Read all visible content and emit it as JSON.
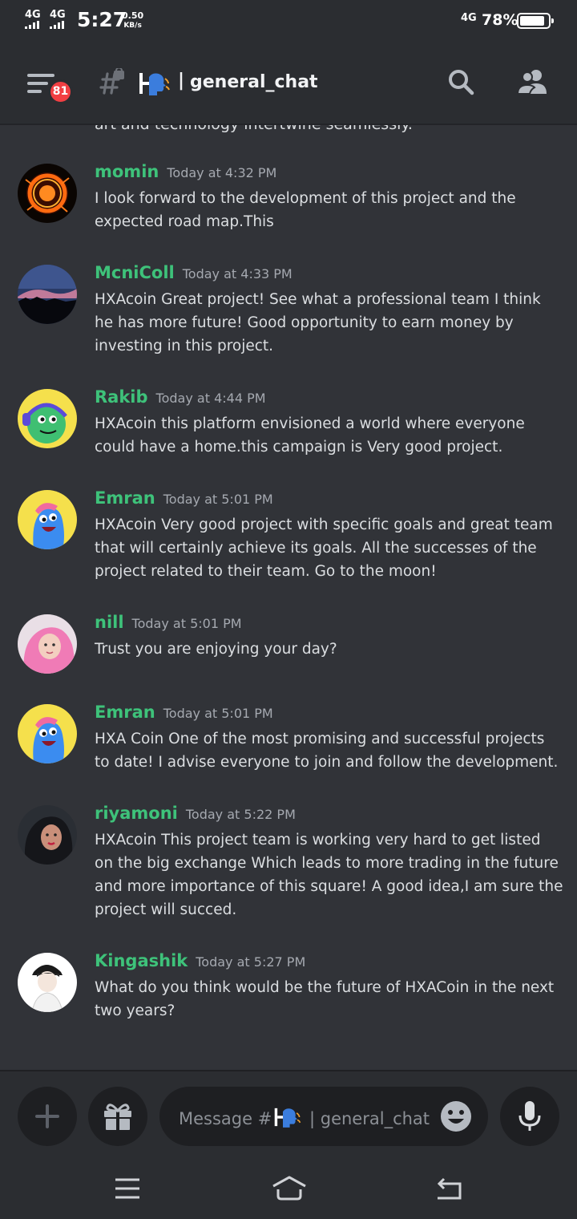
{
  "status_bar": {
    "network_1": "4G",
    "network_2": "4G",
    "time": "5:27",
    "speed_value": "0.50",
    "speed_unit": "KB/s",
    "network_3": "4G",
    "battery": "78%"
  },
  "header": {
    "notification_count": "81",
    "channel_name": "general_chat",
    "channel_emblem_icon": "speaking-head-icon"
  },
  "truncated_line": "art and technology intertwine seamlessly.",
  "messages": [
    {
      "author": "momin",
      "time": "Today at 4:32 PM",
      "text": "I look forward to the development of this project and the expected road map.This"
    },
    {
      "author": "McniColl",
      "time": "Today at 4:33 PM",
      "text": "HXAcoin Great project! See what a professional team I think he has more future! Good opportunity to earn money by investing in this project."
    },
    {
      "author": "Rakib",
      "time": "Today at 4:44 PM",
      "text": "HXAcoin this platform envisioned a world where everyone could have a home.this campaign is Very good project."
    },
    {
      "author": "Emran",
      "time": "Today at 5:01 PM",
      "text": "HXAcoin Very good project with specific goals and great team that will certainly achieve its goals. All the successes of the project related to their team. Go to the moon!"
    },
    {
      "author": "nill",
      "time": "Today at 5:01 PM",
      "text": "Trust you are enjoying your day?"
    },
    {
      "author": "Emran",
      "time": "Today at 5:01 PM",
      "text": "HXA Coin One of the most promising and successful projects to date! I advise everyone to join and follow the development."
    },
    {
      "author": "riyamoni",
      "time": "Today at 5:22 PM",
      "text": "HXAcoin This project team is working very hard to get listed on the big exchange Which leads to more trading in the future and more importance of this square! A good idea,I am sure the project will succed."
    },
    {
      "author": "Kingashik",
      "time": "Today at 5:27 PM",
      "text": "What do you think would be the future of HXACoin in the next two years?"
    }
  ],
  "composer": {
    "placeholder_prefix": "Message #",
    "placeholder_channel": "general_chat"
  },
  "colors": {
    "background": "#313338",
    "author_green": "#3ec27a",
    "badge_red": "#f23f43"
  }
}
